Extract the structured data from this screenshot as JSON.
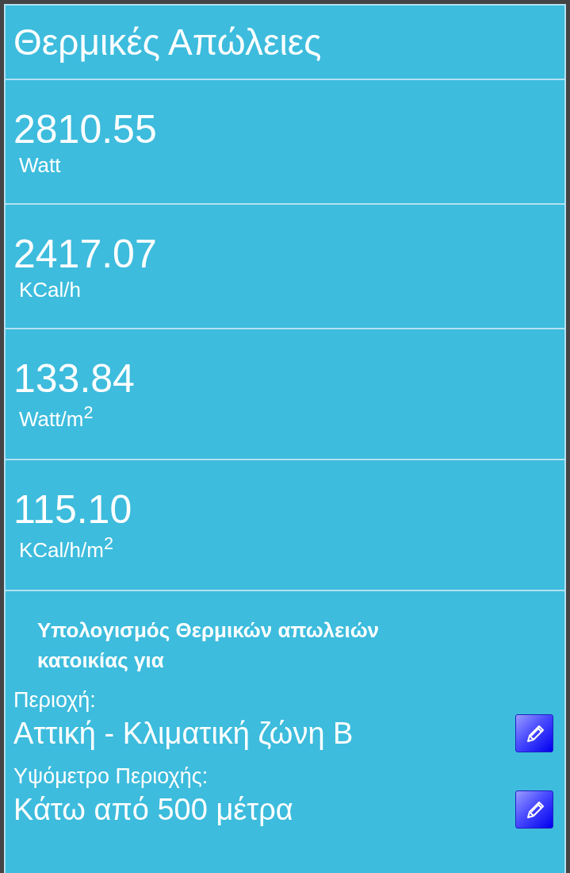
{
  "title": "Θερμικές Απώλειες",
  "results": [
    {
      "value": "2810.55",
      "unit": "Watt"
    },
    {
      "value": "2417.07",
      "unit": "KCal/h"
    },
    {
      "value": "133.84",
      "unit": "Watt/m$^{2}$"
    },
    {
      "value": "115.10",
      "unit": "KCal/h/m$^{2}$"
    }
  ],
  "description": "Υπολογισμός Θερμικών απωλειών κατοικίας για",
  "settings": [
    {
      "label": "Περιοχή:",
      "value": "Αττική - Κλιματική ζώνη Β"
    },
    {
      "label": "Υψόμετρο Περιοχής:",
      "value": "Κάτω από 500 μέτρα"
    }
  ]
}
